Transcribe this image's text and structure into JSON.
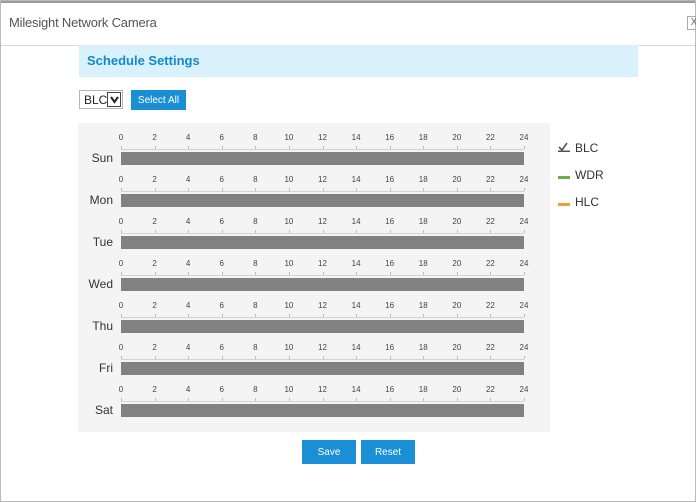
{
  "window": {
    "title": "Milesight Network Camera",
    "close_glyph": "X"
  },
  "header": {
    "title": "Schedule Settings"
  },
  "controls": {
    "mode_value": "BLC",
    "select_all_label": "Select All"
  },
  "schedule": {
    "hour_ticks": [
      "0",
      "2",
      "4",
      "6",
      "8",
      "10",
      "12",
      "14",
      "16",
      "18",
      "20",
      "22",
      "24"
    ],
    "days": [
      "Sun",
      "Mon",
      "Tue",
      "Wed",
      "Thu",
      "Fri",
      "Sat"
    ],
    "bar_color": "#818181"
  },
  "legend": [
    {
      "label": "BLC",
      "color": "#555555",
      "icon": "checkmark-icon"
    },
    {
      "label": "WDR",
      "color": "#6ab04c",
      "icon": "line-icon"
    },
    {
      "label": "HLC",
      "color": "#f0a030",
      "icon": "line-icon"
    }
  ],
  "actions": {
    "save_label": "Save",
    "reset_label": "Reset"
  },
  "colors": {
    "accent": "#1a8fd6",
    "header_bg": "#d9f1fb",
    "header_text": "#1588c8"
  }
}
